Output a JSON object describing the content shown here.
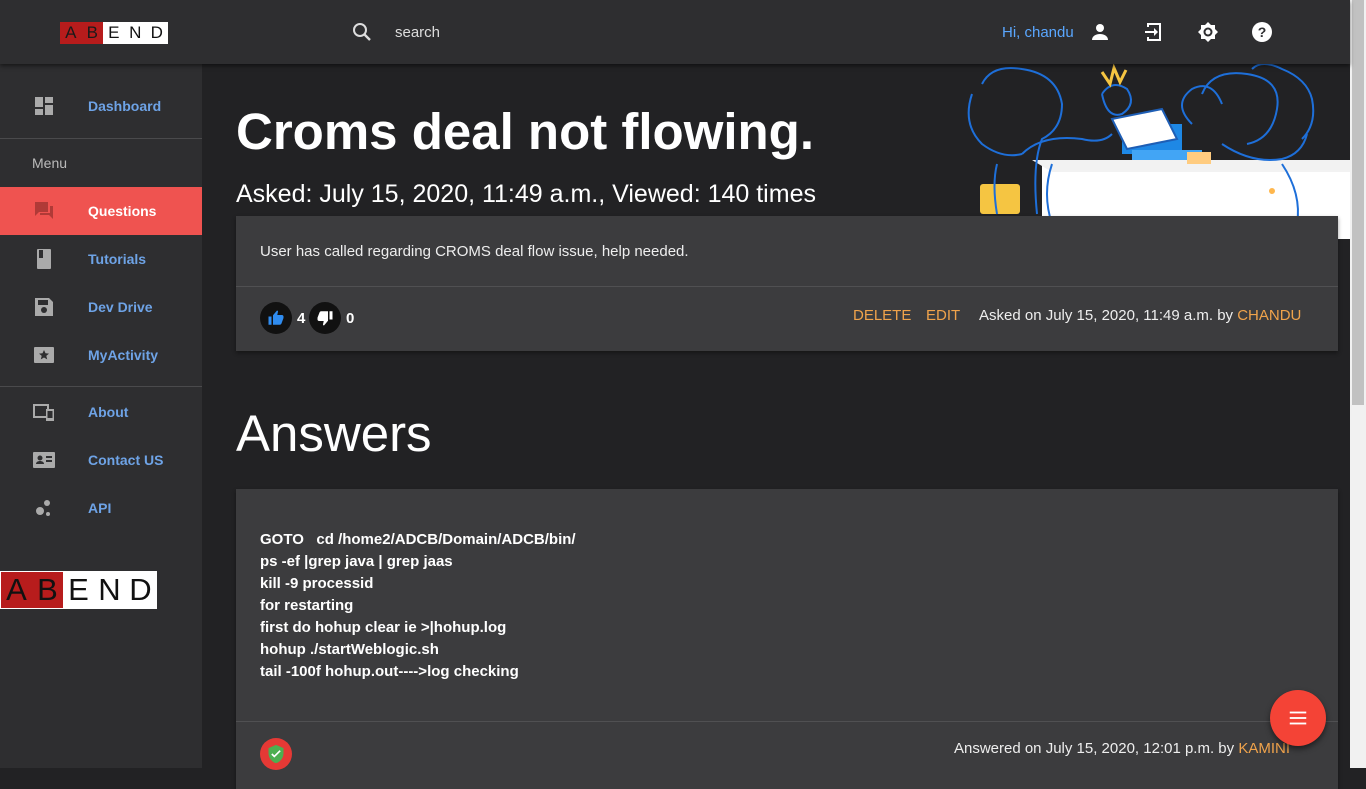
{
  "header": {
    "logo_letters": [
      "A",
      "B",
      "E",
      "N",
      "D"
    ],
    "search_placeholder": "search",
    "greeting": "Hi, chandu",
    "icons": [
      "search-icon",
      "account-icon",
      "logout-icon",
      "brightness-icon",
      "help-icon"
    ]
  },
  "sidebar": {
    "items": [
      {
        "label": "Dashboard",
        "icon": "dashboard-icon"
      },
      {
        "label": "Questions",
        "icon": "forum-icon",
        "active": true
      },
      {
        "label": "Tutorials",
        "icon": "book-icon"
      },
      {
        "label": "Dev Drive",
        "icon": "save-icon"
      },
      {
        "label": "MyActivity",
        "icon": "star-box-icon"
      },
      {
        "label": "About",
        "icon": "devices-icon"
      },
      {
        "label": "Contact US",
        "icon": "contact-card-icon"
      },
      {
        "label": "API",
        "icon": "bubble-chart-icon"
      }
    ],
    "menu_label": "Menu",
    "logo_letters": [
      "A",
      "B",
      "E",
      "N",
      "D"
    ]
  },
  "question": {
    "title": "Croms deal not flowing.",
    "meta": "Asked: July 15, 2020, 11:49 a.m., Viewed: 140 times",
    "body": "User has called regarding CROMS deal flow issue, help needed.",
    "upvotes": "4",
    "downvotes": "0",
    "delete_label": "DELETE",
    "edit_label": "EDIT",
    "asked_on": "Asked on July 15, 2020, 11:49 a.m. by ",
    "author": "CHANDU"
  },
  "answers": {
    "heading": "Answers",
    "items": [
      {
        "lines": [
          "GOTO   cd /home2/ADCB/Domain/ADCB/bin/",
          "ps -ef |grep java | grep jaas",
          "kill -9 processid",
          "for restarting",
          "first do hohup clear ie >|hohup.log",
          "hohup ./startWeblogic.sh",
          "tail -100f hohup.out---->log checking"
        ],
        "answered_on": "Answered on July 15, 2020, 12:01 p.m. by ",
        "author": "KAMINI"
      }
    ]
  },
  "colors": {
    "accent_red": "#ef5350",
    "link_blue": "#6ea3e6",
    "author_orange": "#f0a34b",
    "background": "#222224",
    "surface": "#2e2e30",
    "card": "#3c3c3e"
  }
}
